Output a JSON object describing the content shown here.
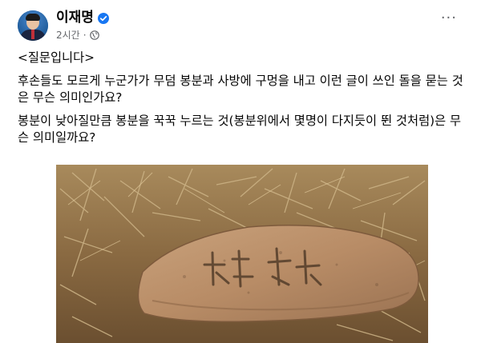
{
  "post": {
    "author_name": "이재명",
    "verified_icon": "verified-badge-icon",
    "timestamp": "2시간",
    "separator": "·",
    "privacy_icon": "globe-icon",
    "more_label": "···",
    "paragraphs": [
      "<질문입니다>",
      "후손들도 모르게 누군가가 무덤 봉분과 사방에 구멍을 내고 이런 글이 쓰인 돌을 묻는 것은 무슨 의미인가요?",
      "봉분이 낮아질만큼 봉분을 꾹꾹 누르는 것(봉분위에서 몇명이 다지듯이 뛴 것처럼)은 무슨 의미일까요?"
    ],
    "photo_subject": "inscribed stone on dry grass"
  },
  "colors": {
    "verified": "#1877f2",
    "meta_text": "#65676b",
    "body_text": "#050505",
    "background": "#ffffff"
  }
}
